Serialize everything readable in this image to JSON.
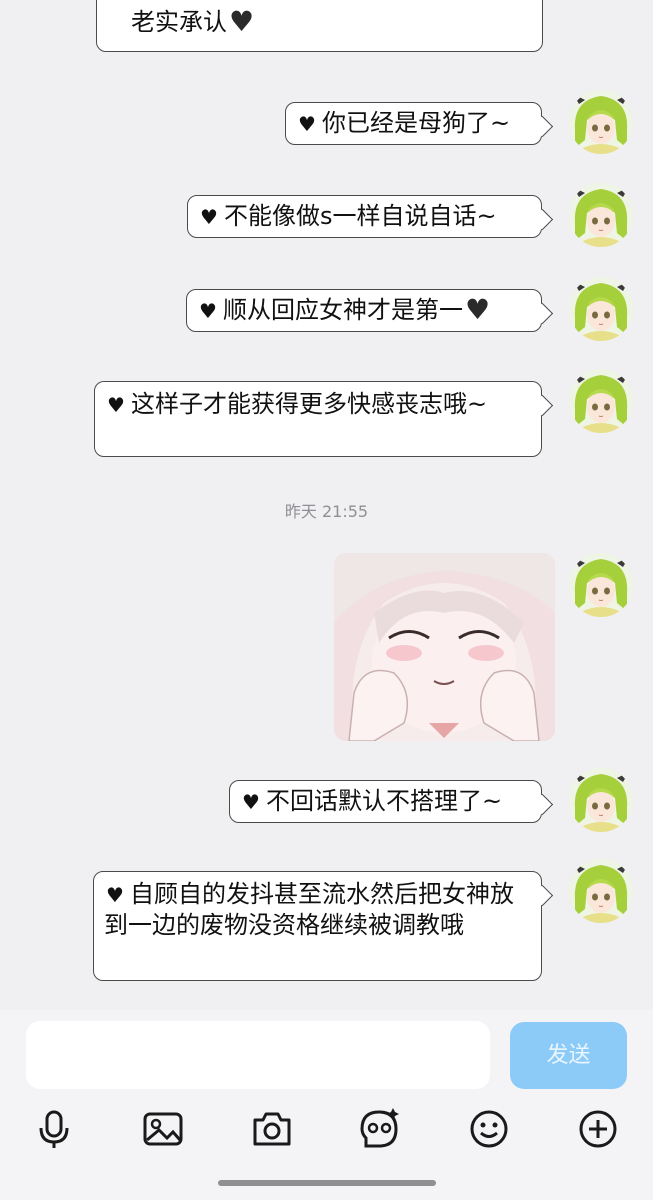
{
  "messages": [
    {
      "text": "老实承认"
    },
    {
      "text": "你已经是母狗了~"
    },
    {
      "text": "不能像做s一样自说自话~"
    },
    {
      "text": "顺从回应女神才是第一"
    },
    {
      "text": "这样子才能获得更多快感丧志哦~"
    },
    {
      "text": "不回话默认不搭理了~"
    },
    {
      "text": "自顾自的发抖甚至流水然后把女神放到一边的废物没资格继续被调教哦"
    }
  ],
  "timestamp": "昨天 21:55",
  "input": {
    "placeholder": "",
    "send_label": "发送"
  },
  "toolbar": {
    "icons": [
      "microphone-icon",
      "image-icon",
      "camera-icon",
      "sticker-icon",
      "emoji-icon",
      "plus-icon"
    ]
  },
  "colors": {
    "background": "#f0f0f2",
    "bubble_border": "#4b4b4b",
    "send_button": "#8ccbf8",
    "avatar_hair": "#a6cf3c"
  }
}
